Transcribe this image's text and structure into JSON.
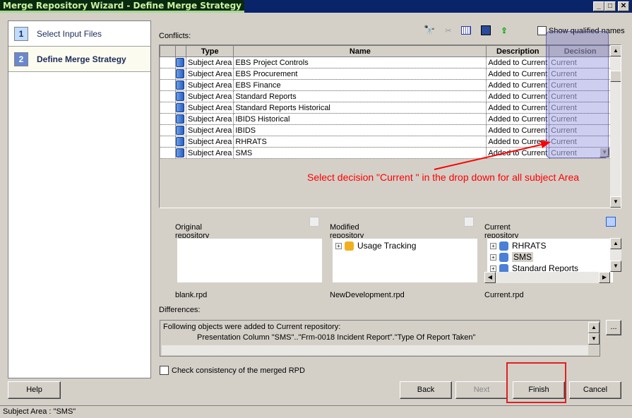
{
  "window": {
    "title": "Merge Repository Wizard - Define Merge Strategy",
    "controls": [
      "_",
      "□",
      "✕"
    ]
  },
  "steps": [
    {
      "num": "1",
      "label": "Select Input Files",
      "active": false
    },
    {
      "num": "2",
      "label": "Define Merge Strategy",
      "active": true
    }
  ],
  "conflicts": {
    "label": "Conflicts:",
    "toolbar": {
      "icons": [
        "binoculars-icon",
        "filter-icon",
        "grid-icon",
        "save-icon",
        "export-icon"
      ],
      "show_qualified_names": "Show qualified names",
      "show_qualified_checked": false
    },
    "columns": [
      "",
      "",
      "Type",
      "Name",
      "Description",
      "Decision"
    ],
    "rows": [
      {
        "type": "Subject Area",
        "name": "EBS Project Controls",
        "description": "Added to Current",
        "decision": "Current"
      },
      {
        "type": "Subject Area",
        "name": "EBS Procurement",
        "description": "Added to Current",
        "decision": "Current"
      },
      {
        "type": "Subject Area",
        "name": "EBS Finance",
        "description": "Added to Current",
        "decision": "Current"
      },
      {
        "type": "Subject Area",
        "name": "Standard Reports",
        "description": "Added to Current",
        "decision": "Current"
      },
      {
        "type": "Subject Area",
        "name": "Standard Reports Historical",
        "description": "Added to Current",
        "decision": "Current"
      },
      {
        "type": "Subject Area",
        "name": "IBIDS Historical",
        "description": "Added to Current",
        "decision": "Current"
      },
      {
        "type": "Subject Area",
        "name": "IBIDS",
        "description": "Added to Current",
        "decision": "Current"
      },
      {
        "type": "Subject Area",
        "name": "RHRATS",
        "description": "Added to Current",
        "decision": "Current"
      },
      {
        "type": "Subject Area",
        "name": "SMS",
        "description": "Added to Current",
        "decision": "Current"
      }
    ]
  },
  "annotation": {
    "text": "Select decision \"Current \" in the drop down for all subject Area",
    "color": "#ff0000"
  },
  "repositories": {
    "original": {
      "label": "Original repository",
      "file": "blank.rpd",
      "items": []
    },
    "modified": {
      "label": "Modified repository",
      "file": "NewDevelopment.rpd",
      "items": [
        "Usage Tracking"
      ]
    },
    "current": {
      "label": "Current repository",
      "file": "Current.rpd",
      "items": [
        "RHRATS",
        "SMS",
        "Standard Reports"
      ],
      "selected": "SMS"
    }
  },
  "differences": {
    "label": "Differences:",
    "line1": "Following objects were added to Current repository:",
    "line2": "Presentation Column \"SMS\"..\"Frm-0018 Incident Report\".\"Type Of Report Taken\"",
    "more_button": "..."
  },
  "check_consistency": {
    "label": "Check consistency of the merged RPD",
    "checked": false
  },
  "buttons": {
    "help": "Help",
    "back": "Back",
    "next": "Next",
    "finish": "Finish",
    "cancel": "Cancel"
  },
  "status": "Subject Area : \"SMS\""
}
